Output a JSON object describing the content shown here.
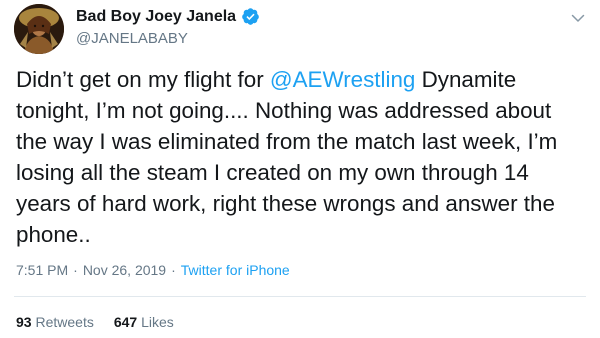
{
  "colors": {
    "link": "#1da1f2",
    "verified": "#1da1f2",
    "secondary_text": "#657786",
    "primary_text": "#14171a"
  },
  "author": {
    "display_name": "Bad Boy Joey Janela",
    "handle": "@JANELABABY",
    "verified_icon": "verified-badge-icon",
    "menu_icon": "chevron-down-icon"
  },
  "tweet": {
    "text_before_mention": "Didn’t get on my flight for ",
    "mention": "@AEWrestling",
    "text_after_mention": " Dynamite tonight, I’m not going.... Nothing was addressed about the way I was eliminated from the match last week, I’m losing all the steam I created on my own through 14 years of hard work, right these wrongs and answer the phone..",
    "time": "7:51 PM",
    "separator": "·",
    "date": "Nov 26, 2019",
    "source": "Twitter for iPhone"
  },
  "stats": {
    "retweets_count": "93",
    "retweets_label": "Retweets",
    "likes_count": "647",
    "likes_label": "Likes"
  }
}
